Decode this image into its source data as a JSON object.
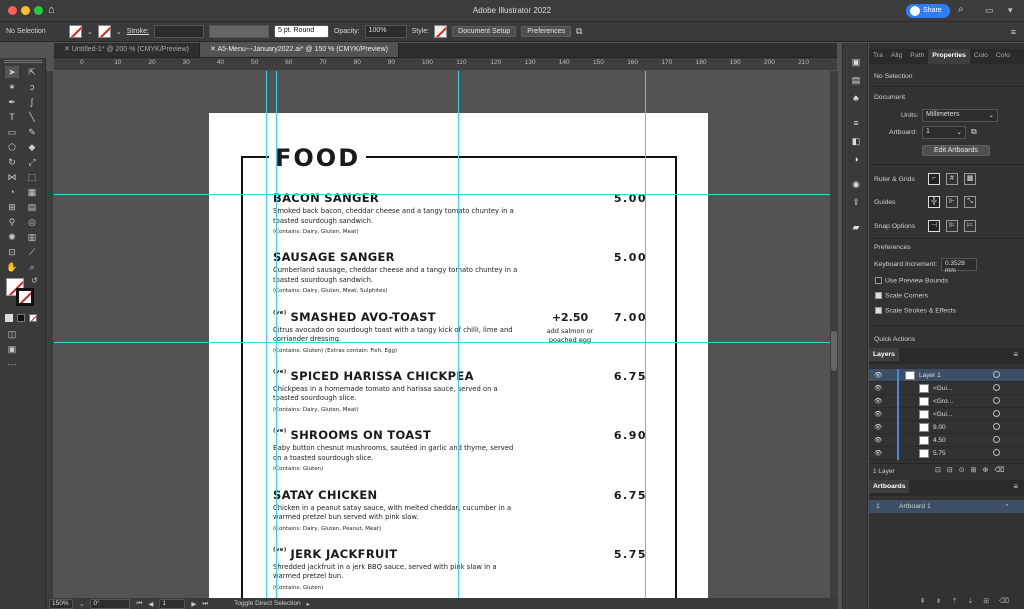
{
  "app": {
    "title": "Adobe Illustrator 2022",
    "share_label": "Share",
    "home_icon": "home-icon"
  },
  "control_bar": {
    "selection": "No Selection",
    "stroke_label": "Stroke:",
    "brush": "5 pt. Round",
    "opacity_label": "Opacity:",
    "opacity_value": "100%",
    "style_label": "Style:",
    "document_setup": "Document Setup",
    "preferences": "Preferences"
  },
  "tabs": [
    {
      "label": "Untitled-1* @ 200 % (CMYK/Preview)"
    },
    {
      "label": "A5-Menu---January2022.ai* @ 150 % (CMYK/Preview)"
    }
  ],
  "ruler_marks": [
    "0",
    "10",
    "20",
    "30",
    "40",
    "50",
    "60",
    "70",
    "80",
    "90",
    "100",
    "110",
    "120",
    "130",
    "140",
    "150",
    "160",
    "170",
    "180",
    "190",
    "200",
    "210"
  ],
  "menu": {
    "heading": "FOOD",
    "items": [
      {
        "name": "BACON SANGER",
        "vegan": "",
        "price": "5.00",
        "desc": "Smoked back bacon, cheddar cheese and a tangy tomato chuntey in a toasted sourdough sandwich.",
        "contains": "(Contains: Dairy, Gluten, Meat)"
      },
      {
        "name": "SAUSAGE SANGER",
        "vegan": "",
        "price": "5.00",
        "desc": "Cumberland sausage, cheddar cheese and a tangy tomato chuntey in a toasted sourdough sandwich.",
        "contains": "(Contains: Dairy, Gluten, Meat, Sulphites)"
      },
      {
        "name": "SMASHED AVO-TOAST",
        "vegan": "(ve)",
        "price": "7.00",
        "desc": "Citrus avocado on sourdough toast with a tangy kick of chilli, lime and corriander dressing.",
        "contains": "(Contains: Gluten) (Extras contain: Fish, Egg)",
        "extra_price": "+2.50",
        "extra_label": "add salmon or poached egg"
      },
      {
        "name": "SPICED HARISSA CHICKPEA",
        "vegan": "(ve)",
        "price": "6.75",
        "desc": "Chickpeas in a homemade tomato and harissa sauce, served on a toasted sourdough slice.",
        "contains": "(Contains: Dairy, Gluten, Meat)"
      },
      {
        "name": "SHROOMS ON TOAST",
        "vegan": "(ve)",
        "price": "6.90",
        "desc": "Baby button chesnut mushrooms, sautéed in garlic and thyme, served on a toasted sourdough slice.",
        "contains": "(Contains: Gluten)"
      },
      {
        "name": "SATAY CHICKEN",
        "vegan": "",
        "price": "6.75",
        "desc": "Chicken in a peanut satay sauce, with melted cheddar, cucumber in a warmed pretzel bun served with pink slaw.",
        "contains": "(Contains: Dairy, Gluten, Peanut, Meat)"
      },
      {
        "name": "JERK JACKFRUIT",
        "vegan": "(ve)",
        "price": "5.75",
        "desc": "Shredded jackfruit in a jerk BBQ sauce, served with pink slaw in a warmed pretzel bun.",
        "contains": "(Contains: Gluten)"
      }
    ]
  },
  "status": {
    "zoom": "150%",
    "rotation": "0°",
    "artboard": "1",
    "action": "Toggle Direct Selection"
  },
  "properties": {
    "tabs": [
      "Tra",
      "Alig",
      "Path",
      "Properties",
      "Colo",
      "Colo"
    ],
    "no_selection": "No Selection",
    "document_label": "Document",
    "units_label": "Units:",
    "units_value": "Millimeters",
    "artboard_label": "Artboard:",
    "artboard_value": "1",
    "edit_artboards": "Edit Artboards",
    "ruler_grids": "Ruler & Grids",
    "guides": "Guides",
    "snap_options": "Snap Options",
    "preferences": "Preferences",
    "keyboard_increment_label": "Keyboard Increment:",
    "keyboard_increment_value": "0.3528 mm",
    "use_preview_bounds": "Use Preview Bounds",
    "scale_corners": "Scale Corners",
    "scale_strokes": "Scale Strokes & Effects",
    "quick_actions": "Quick Actions"
  },
  "layers": {
    "title": "Layers",
    "rows": [
      "Layer 1",
      "<Gui...",
      "<Gro...",
      "<Gui...",
      "9.00",
      "4.50",
      "5.75"
    ],
    "count": "1 Layer"
  },
  "artboards": {
    "title": "Artboards",
    "rows": [
      {
        "num": "1",
        "name": "Artboard 1"
      }
    ]
  },
  "colors": {
    "guide": "#35d6e6",
    "accent": "#2f7cf6",
    "selected_layer": "#4a8bd6"
  }
}
